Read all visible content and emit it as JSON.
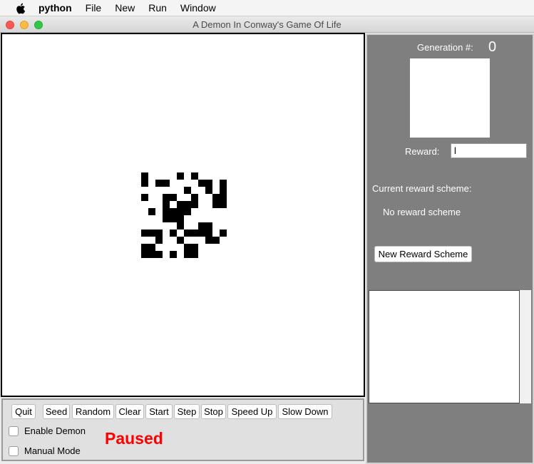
{
  "menubar": {
    "apple_icon": "apple-icon",
    "app_name": "python",
    "items": [
      "File",
      "New",
      "Run",
      "Window"
    ]
  },
  "window": {
    "title": "A Demon In Conway's Game Of Life"
  },
  "board": {
    "background": "#ffffff",
    "cell_color": "#000000",
    "grid_size": 12,
    "live_cells": [
      [
        0,
        0
      ],
      [
        0,
        5
      ],
      [
        0,
        7
      ],
      [
        1,
        0
      ],
      [
        1,
        2
      ],
      [
        1,
        3
      ],
      [
        1,
        8
      ],
      [
        1,
        9
      ],
      [
        1,
        11
      ],
      [
        2,
        6
      ],
      [
        2,
        9
      ],
      [
        2,
        11
      ],
      [
        3,
        0
      ],
      [
        3,
        3
      ],
      [
        3,
        4
      ],
      [
        3,
        7
      ],
      [
        3,
        10
      ],
      [
        3,
        11
      ],
      [
        4,
        3
      ],
      [
        4,
        5
      ],
      [
        4,
        6
      ],
      [
        4,
        7
      ],
      [
        4,
        10
      ],
      [
        4,
        11
      ],
      [
        5,
        1
      ],
      [
        5,
        3
      ],
      [
        5,
        4
      ],
      [
        5,
        5
      ],
      [
        5,
        6
      ],
      [
        6,
        3
      ],
      [
        6,
        4
      ],
      [
        6,
        5
      ],
      [
        7,
        5
      ],
      [
        7,
        8
      ],
      [
        7,
        9
      ],
      [
        8,
        0
      ],
      [
        8,
        1
      ],
      [
        8,
        2
      ],
      [
        8,
        4
      ],
      [
        8,
        6
      ],
      [
        8,
        7
      ],
      [
        8,
        8
      ],
      [
        8,
        9
      ],
      [
        8,
        11
      ],
      [
        9,
        2
      ],
      [
        9,
        5
      ],
      [
        9,
        9
      ],
      [
        9,
        10
      ],
      [
        10,
        0
      ],
      [
        10,
        1
      ],
      [
        10,
        6
      ],
      [
        10,
        7
      ],
      [
        11,
        0
      ],
      [
        11,
        1
      ],
      [
        11,
        2
      ],
      [
        11,
        4
      ],
      [
        11,
        6
      ],
      [
        11,
        7
      ]
    ]
  },
  "controls": {
    "buttons": [
      "Quit",
      "Seed",
      "Random",
      "Clear",
      "Start",
      "Step",
      "Stop",
      "Speed Up",
      "Slow Down"
    ],
    "enable_demon_label": "Enable Demon",
    "enable_demon_checked": false,
    "manual_mode_label": "Manual Mode",
    "manual_mode_checked": false,
    "status": "Paused",
    "status_color": "#ff0000"
  },
  "side": {
    "background": "#7f7f7f",
    "generation_label": "Generation #:",
    "generation_value": "0",
    "reward_label": "Reward:",
    "reward_value": "l",
    "scheme_label": "Current reward scheme:",
    "scheme_value": "No reward scheme",
    "new_scheme_button": "New Reward Scheme"
  }
}
